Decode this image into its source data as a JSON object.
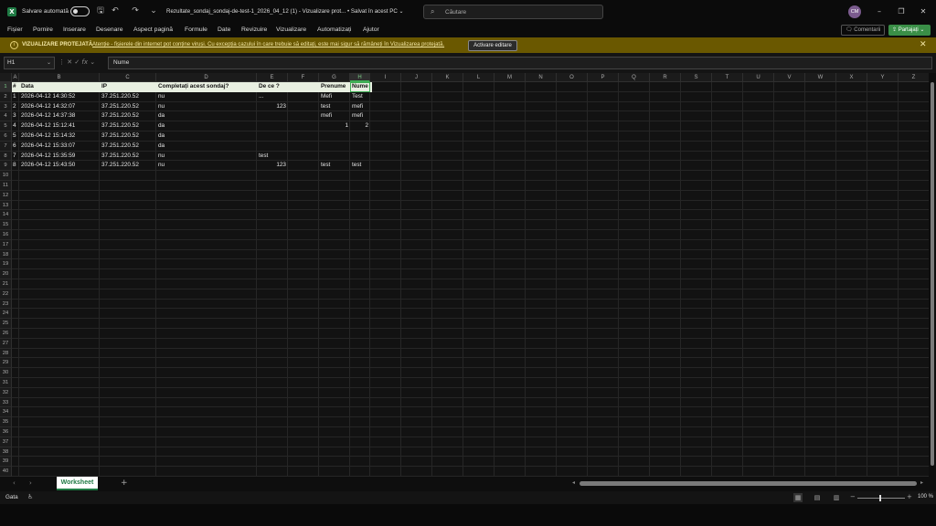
{
  "titlebar": {
    "autosave_label": "Salvare automată",
    "doc_title": "Rezultate_sondaj_sondaj-de-test-1_2026_04_12 (1)  -  Vizualizare prot...  •  Salvat în acest PC ⌄",
    "search_placeholder": "Căutare",
    "avatar_initials": "CM"
  },
  "menu": [
    "Fișier",
    "Pornire",
    "Inserare",
    "Desenare",
    "Aspect pagină",
    "Formule",
    "Date",
    "Revizuire",
    "Vizualizare",
    "Automatizați",
    "Ajutor"
  ],
  "actions": {
    "comments_label": "Comentarii",
    "share_label": "Partajați"
  },
  "protected_view": {
    "title": "VIZUALIZARE PROTEJATĂ",
    "message": "Atenție - fișierele din internet pot conține viruși. Cu excepția cazului în care trebuie să editați, este mai sigur să rămâneți în Vizualizarea protejată.",
    "enable_label": "Activare editare"
  },
  "formula": {
    "name_box": "H1",
    "value": "Nume"
  },
  "columns": [
    "A",
    "B",
    "C",
    "D",
    "E",
    "F",
    "G",
    "H",
    "I",
    "J",
    "K",
    "L",
    "M",
    "N",
    "O",
    "P",
    "Q",
    "R",
    "S",
    "T",
    "U",
    "V",
    "W",
    "X",
    "Y",
    "Z"
  ],
  "selected_cell": "H1",
  "table": {
    "headers": [
      "#",
      "Data",
      "IP",
      "Completați acest sondaj?",
      "De ce ?",
      "",
      "Prenume",
      "Nume"
    ],
    "rows": [
      [
        "1",
        "2026-04-12 14:30:52",
        "37.251.220.52",
        "nu",
        "...",
        "",
        "Mefi",
        "Test"
      ],
      [
        "2",
        "2026-04-12 14:32:07",
        "37.251.220.52",
        "nu",
        "123",
        "",
        "test",
        "mefi"
      ],
      [
        "3",
        "2026-04-12 14:37:38",
        "37.251.220.52",
        "da",
        "",
        "",
        "mefi",
        "mefi"
      ],
      [
        "4",
        "2026-04-12 15:12:41",
        "37.251.220.52",
        "da",
        "",
        "",
        "1",
        "2"
      ],
      [
        "5",
        "2026-04-12 15:14:32",
        "37.251.220.52",
        "da",
        "",
        "",
        "",
        ""
      ],
      [
        "6",
        "2026-04-12 15:33:07",
        "37.251.220.52",
        "da",
        "",
        "",
        "",
        ""
      ],
      [
        "7",
        "2026-04-12 15:35:59",
        "37.251.220.52",
        "nu",
        "test",
        "",
        "",
        ""
      ],
      [
        "8",
        "2026-04-12 15:43:50",
        "37.251.220.52",
        "nu",
        "123",
        "",
        "test",
        "test"
      ]
    ]
  },
  "row_count": 40,
  "sheets": [
    "Worksheet"
  ],
  "status": {
    "text": "Gata",
    "zoom": "100 %"
  },
  "colors": {
    "accent": "#3fae55",
    "protected_bar": "#6a5800",
    "header_fill": "#e8efe1"
  }
}
